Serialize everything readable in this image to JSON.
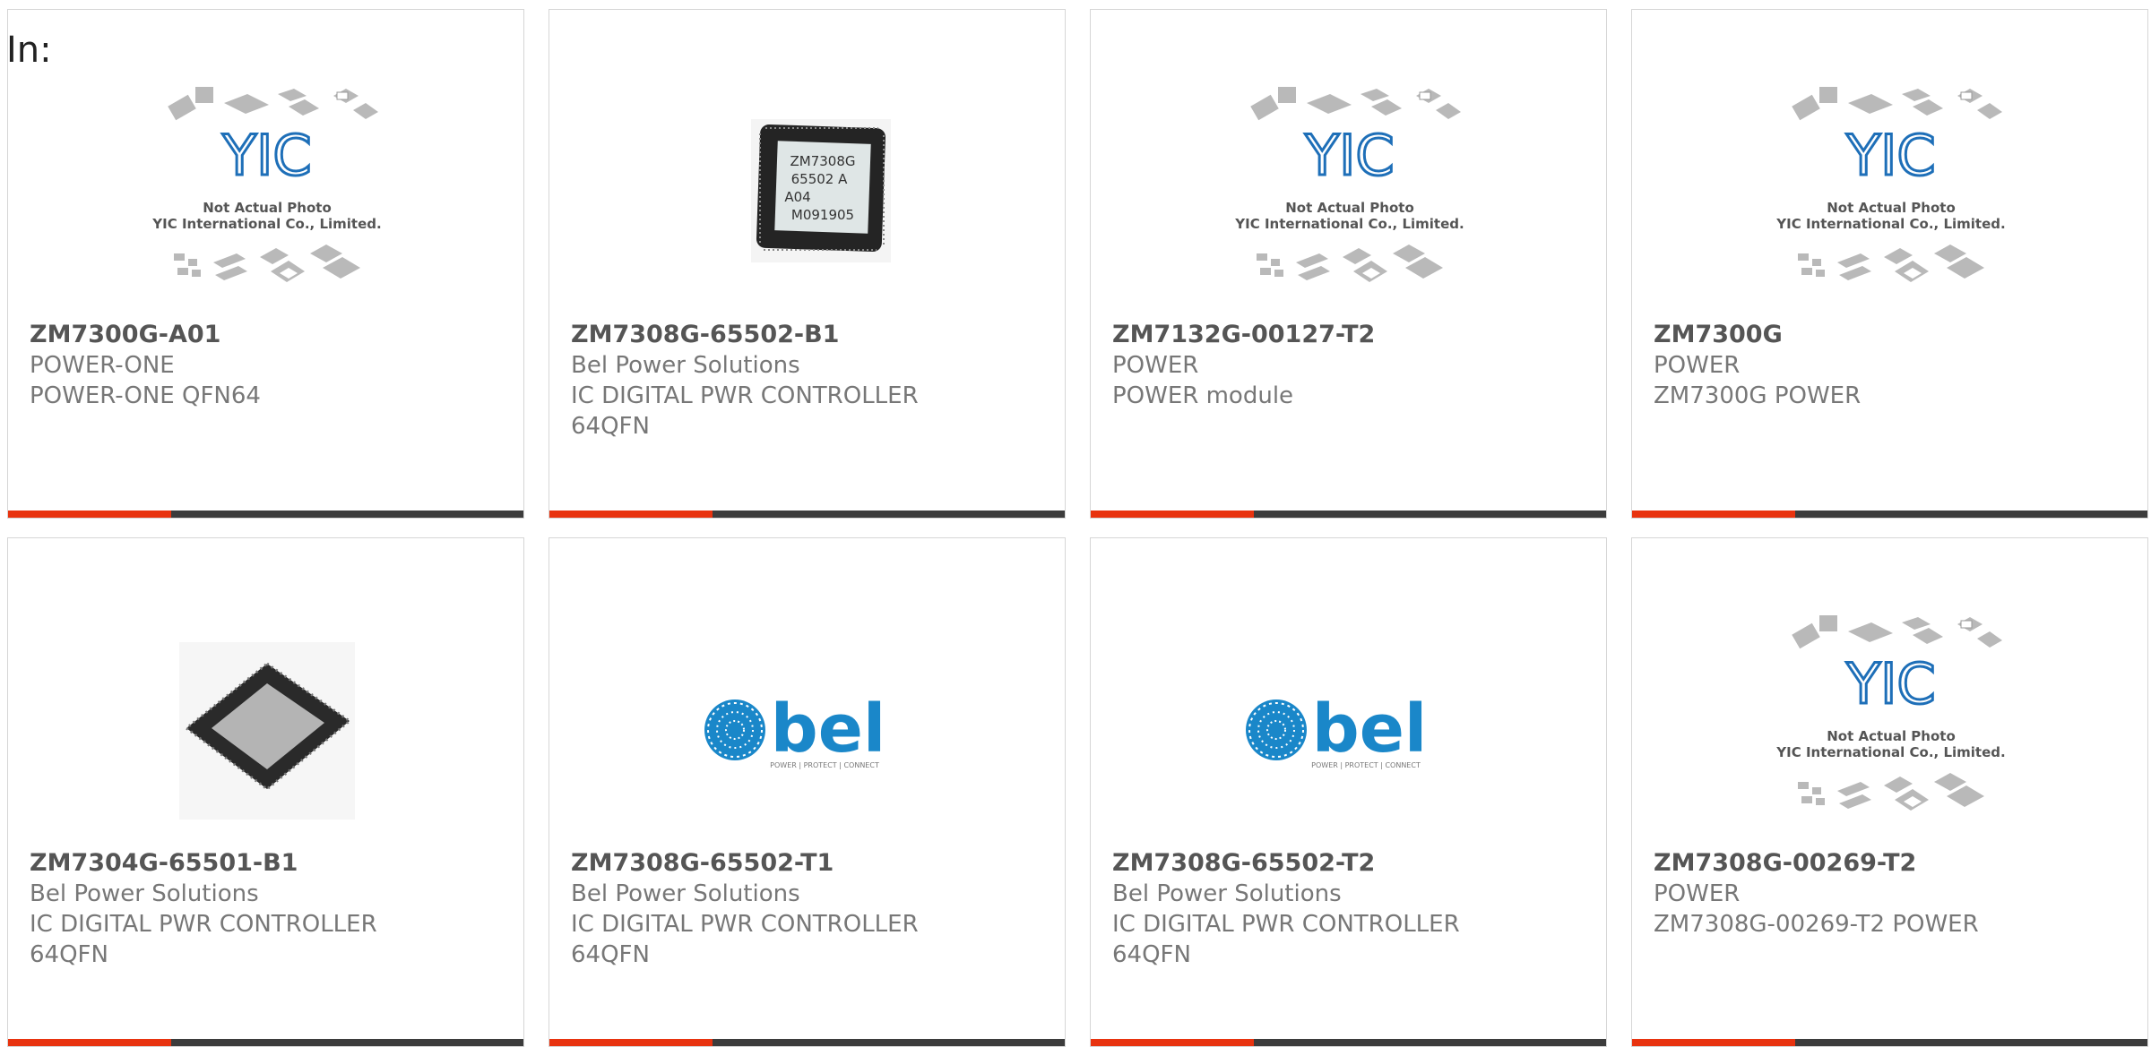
{
  "page": {
    "label": "In:"
  },
  "colors": {
    "accent": "#e8330f",
    "bar": "#3c3c3c",
    "border": "#d6d6d6",
    "text": "#777777",
    "title": "#555555"
  },
  "placeholder": {
    "line1": "Not Actual Photo",
    "line2": "YIC International Co., Limited.",
    "logo": "YIC"
  },
  "bel_logo": {
    "brand": "bel",
    "tagline": "POWER | PROTECT | CONNECT"
  },
  "chip_photo": {
    "lines": [
      "ZM7308G",
      "65502 A",
      "A04",
      "M091905"
    ]
  },
  "products": [
    {
      "pn": "ZM7300G-A01",
      "mfr": "POWER-ONE",
      "desc": "POWER-ONE QFN64",
      "image": "placeholder-icon"
    },
    {
      "pn": "ZM7308G-65502-B1",
      "mfr": "Bel Power Solutions",
      "desc": "IC DIGITAL PWR CONTROLLER 64QFN",
      "image": "chip-photo-icon"
    },
    {
      "pn": "ZM7132G-00127-T2",
      "mfr": "POWER",
      "desc": "POWER module",
      "image": "placeholder-icon"
    },
    {
      "pn": "ZM7300G",
      "mfr": "POWER",
      "desc": "ZM7300G POWER",
      "image": "placeholder-icon"
    },
    {
      "pn": "ZM7304G-65501-B1",
      "mfr": "Bel Power Solutions",
      "desc": "IC DIGITAL PWR CONTROLLER 64QFN",
      "image": "qfn-chip-icon"
    },
    {
      "pn": "ZM7308G-65502-T1",
      "mfr": "Bel Power Solutions",
      "desc": "IC DIGITAL PWR CONTROLLER 64QFN",
      "image": "bel-logo-icon"
    },
    {
      "pn": "ZM7308G-65502-T2",
      "mfr": "Bel Power Solutions",
      "desc": "IC DIGITAL PWR CONTROLLER 64QFN",
      "image": "bel-logo-icon"
    },
    {
      "pn": "ZM7308G-00269-T2",
      "mfr": "POWER",
      "desc": "ZM7308G-00269-T2 POWER",
      "image": "placeholder-icon"
    }
  ]
}
